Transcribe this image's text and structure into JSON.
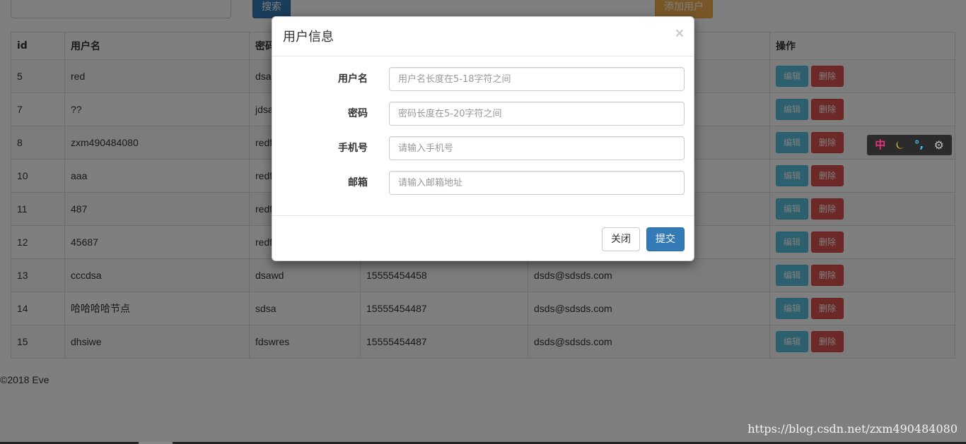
{
  "toolbar": {
    "search_label": "搜索",
    "add_user_label": "添加用户"
  },
  "table": {
    "headers": {
      "id": "id",
      "username": "用户名",
      "password": "密码",
      "phone": "",
      "email": "",
      "actions": "操作"
    },
    "rows": [
      {
        "id": "5",
        "username": "red",
        "password": "dsa",
        "phone": "",
        "email": ""
      },
      {
        "id": "7",
        "username": "??",
        "password": "jdsa",
        "phone": "",
        "email": ""
      },
      {
        "id": "8",
        "username": "zxm490484080",
        "password": "redf",
        "phone": "",
        "email": ""
      },
      {
        "id": "10",
        "username": "aaa",
        "password": "redf",
        "phone": "",
        "email": ""
      },
      {
        "id": "11",
        "username": "487",
        "password": "redf",
        "phone": "",
        "email": ""
      },
      {
        "id": "12",
        "username": "45687",
        "password": "redf",
        "phone": "",
        "email": ""
      },
      {
        "id": "13",
        "username": "cccdsa",
        "password": "dsawd",
        "phone": "15555454458",
        "email": "dsds@sdsds.com"
      },
      {
        "id": "14",
        "username": "哈哈哈哈节点",
        "password": "sdsa",
        "phone": "15555454487",
        "email": "dsds@sdsds.com"
      },
      {
        "id": "15",
        "username": "dhsiwe",
        "password": "fdswres",
        "phone": "15555454487",
        "email": "dsds@sdsds.com"
      }
    ],
    "edit_label": "编辑",
    "delete_label": "删除"
  },
  "footer": {
    "copyright": "©2018 Eve"
  },
  "watermark": "https://blog.csdn.net/zxm490484080",
  "ime": {
    "mode": "中",
    "moon": "⏾",
    "punct": "°,",
    "gear": "⚙"
  },
  "modal": {
    "title": "用户信息",
    "close_symbol": "×",
    "fields": {
      "username": {
        "label": "用户名",
        "placeholder": "用户名长度在5-18字符之间",
        "value": ""
      },
      "password": {
        "label": "密码",
        "placeholder": "密码长度在5-20字符之间",
        "value": ""
      },
      "phone": {
        "label": "手机号",
        "placeholder": "请输入手机号",
        "value": ""
      },
      "email": {
        "label": "邮箱",
        "placeholder": "请输入邮箱地址",
        "value": ""
      }
    },
    "close_button": "关闭",
    "submit_button": "提交"
  },
  "colors": {
    "primary": "#337ab7",
    "warning": "#f0ad4e",
    "info": "#5bc0de",
    "danger": "#d9534f",
    "backdrop": "rgba(0,0,0,0.5)"
  }
}
